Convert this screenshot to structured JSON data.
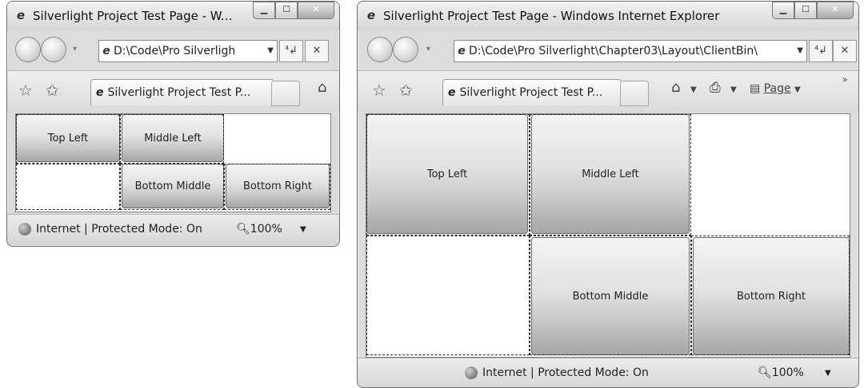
{
  "small_window": {
    "title": "Silverlight Project Test Page - W...",
    "address": "D:\\Code\\Pro Silverligh",
    "tab_label": "Silverlight Project Test P...",
    "buttons": {
      "top_left": "Top Left",
      "middle_left": "Middle Left",
      "bottom_middle": "Bottom Middle",
      "bottom_right": "Bottom Right"
    },
    "status": "Internet | Protected Mode: On",
    "zoom": "100%"
  },
  "large_window": {
    "title": "Silverlight Project Test Page - Windows Internet Explorer",
    "address": "D:\\Code\\Pro Silverlight\\Chapter03\\Layout\\ClientBin\\",
    "tab_label": "Silverlight Project Test P...",
    "page_menu": "Page",
    "buttons": {
      "top_left": "Top Left",
      "middle_left": "Middle Left",
      "bottom_middle": "Bottom Middle",
      "bottom_right": "Bottom Right"
    },
    "status": "Internet | Protected Mode: On",
    "zoom": "100%"
  },
  "icons": {
    "back": "back-arrow-icon",
    "forward": "forward-arrow-icon",
    "refresh": "refresh-icon",
    "stop": "stop-icon",
    "favorites": "star-icon",
    "add_favorites": "add-favorites-icon",
    "home": "home-icon",
    "print": "print-icon",
    "page": "page-icon",
    "internet_zone": "globe-icon",
    "zoom": "magnifier-icon"
  }
}
